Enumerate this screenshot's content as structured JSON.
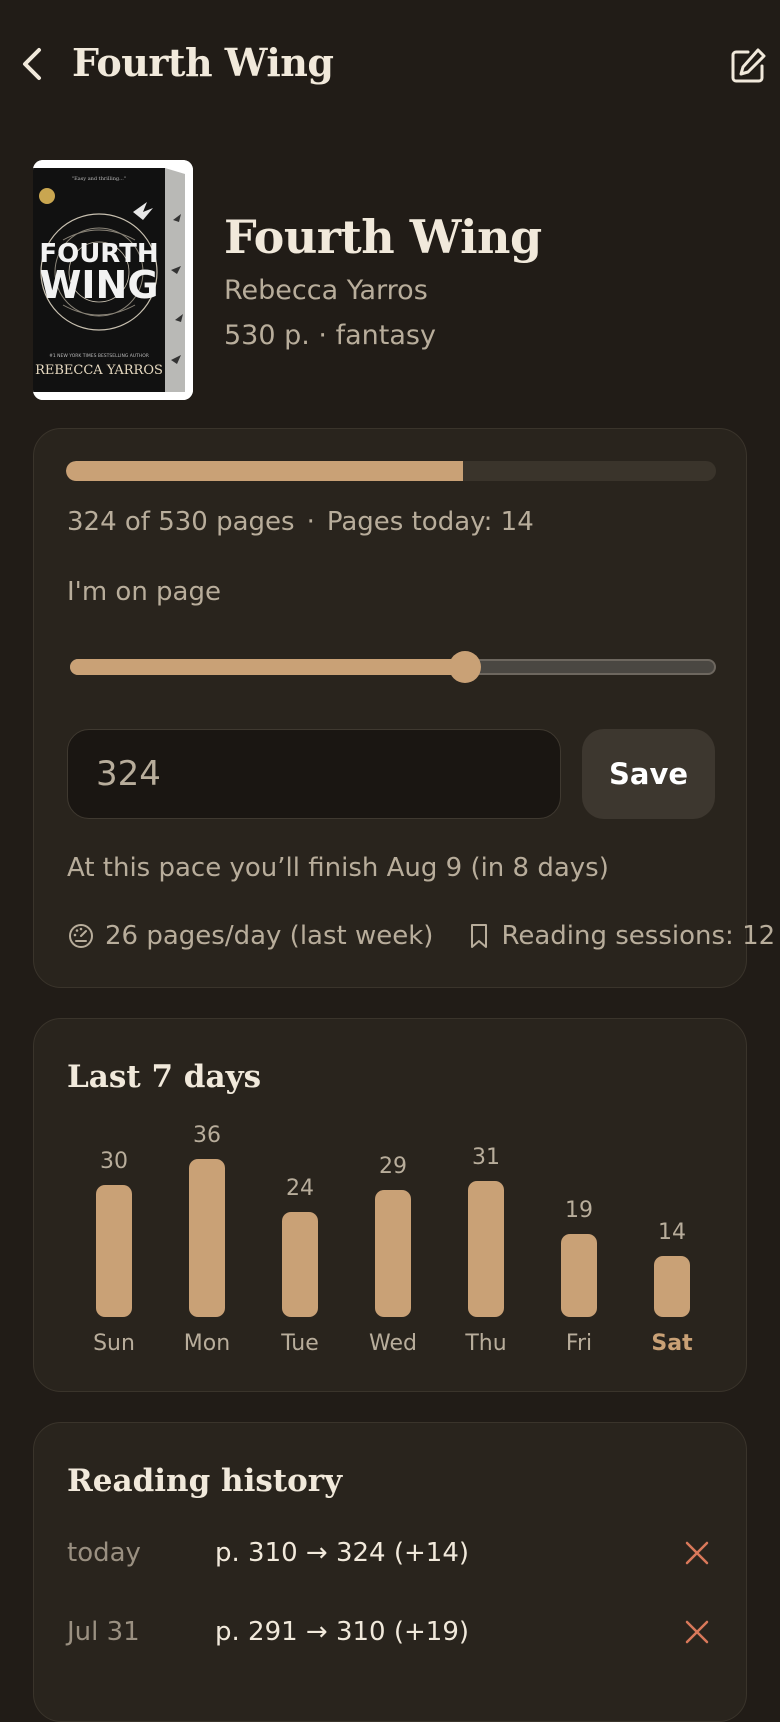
{
  "header": {
    "title": "Fourth Wing",
    "back_icon": "chevron-left-icon",
    "edit_icon": "edit-icon"
  },
  "book": {
    "title": "Fourth Wing",
    "author": "Rebecca Yarros",
    "meta": "530 p. · fantasy",
    "cover": {
      "top_quote": "\"Easy and thrilling...\"",
      "word1": "FOURTH",
      "word2": "WING",
      "tagline": "#1 NEW YORK TIMES BESTSELLING AUTHOR",
      "author": "REBECCA YARROS"
    }
  },
  "progress": {
    "current_page": 324,
    "total_pages": 530,
    "fraction": 0.611,
    "pages_text": "324 of 530 pages",
    "separator": "·",
    "today_text": "Pages today: 14",
    "on_page_label": "I'm on page",
    "input_value": "324",
    "save_label": "Save",
    "finish_text": "At this pace you’ll finish Aug 9 (in 8 days)",
    "pace_text": "26 pages/day (last week)",
    "sessions_text": "Reading sessions: 12"
  },
  "chart": {
    "heading": "Last 7 days"
  },
  "chart_data": {
    "type": "bar",
    "categories": [
      "Sun",
      "Mon",
      "Tue",
      "Wed",
      "Thu",
      "Fri",
      "Sat"
    ],
    "values": [
      30,
      36,
      24,
      29,
      31,
      19,
      14
    ],
    "highlight": "Sat",
    "colors": {
      "bar": "#c9a176",
      "highlight_label": "#c9a176"
    }
  },
  "history": {
    "heading": "Reading history",
    "rows": [
      {
        "date": "today",
        "range": "p. 310 → 324 (+14)"
      },
      {
        "date": "Jul 31",
        "range": "p. 291 → 310 (+19)"
      }
    ]
  },
  "colors": {
    "background": "#211c17",
    "card": "#29241d",
    "accent": "#c9a176",
    "delete": "#d9785a"
  }
}
